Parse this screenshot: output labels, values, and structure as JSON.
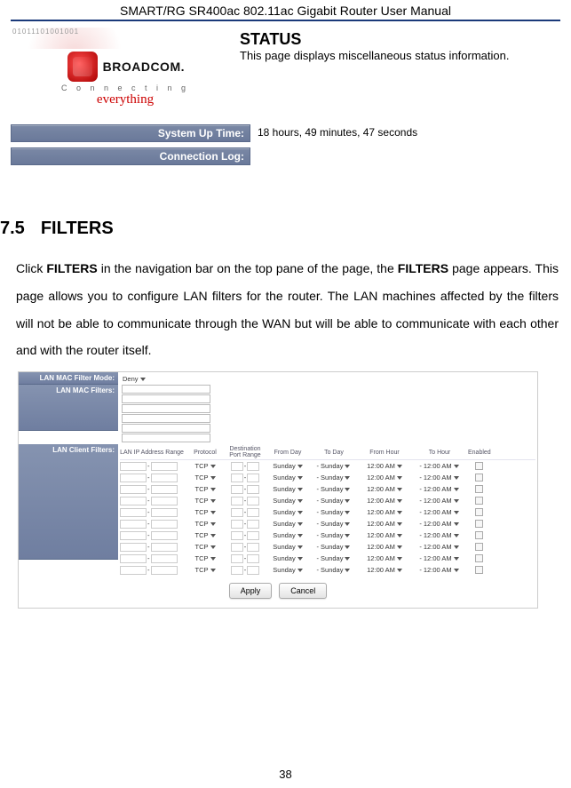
{
  "doc": {
    "header": "SMART/RG SR400ac 802.11ac Gigabit Router User Manual",
    "page_number": "38"
  },
  "status_panel": {
    "logo_bits": "01011101001001",
    "brand": "BROADCOM.",
    "tagline_prefix": "C o n n e c t i n g",
    "tagline_emphasis": "everything",
    "title": "STATUS",
    "description": "This page displays miscellaneous status information.",
    "rows": [
      {
        "label": "System Up Time:",
        "value": "18 hours, 49 minutes, 47 seconds"
      },
      {
        "label": "Connection Log:",
        "value": ""
      }
    ]
  },
  "section": {
    "number": "7.5",
    "title": "FILTERS",
    "paragraph_parts": {
      "p1a": "Click ",
      "p1b": "FILTERS",
      "p1c": " in the navigation bar on the top pane of the page, the ",
      "p1d": "FILTERS",
      "p1e": " page appears. This page allows you to configure LAN filters for the router. The LAN machines affected by the filters will not be able to communicate through the WAN but will be able to communicate with each other and with the router itself."
    }
  },
  "filters_ui": {
    "mac_mode_label": "LAN MAC Filter Mode:",
    "mac_list_label": "LAN MAC Filters:",
    "mac_mode_value": "Deny",
    "mac_input_count": 6,
    "client_label": "LAN Client Filters:",
    "columns": {
      "ip": "LAN IP Address Range",
      "protocol": "Protocol",
      "port": "Destination Port Range",
      "from_day": "From Day",
      "to_day": "To Day",
      "from_hour": "From Hour",
      "to_hour": "To Hour",
      "enabled": "Enabled"
    },
    "row_defaults": {
      "protocol": "TCP",
      "port_sep": "-",
      "from_day": "Sunday",
      "to_day": "Sunday",
      "from_hour": "12:00 AM",
      "to_hour": "12:00 AM"
    },
    "row_count": 10,
    "buttons": {
      "apply": "Apply",
      "cancel": "Cancel"
    }
  }
}
